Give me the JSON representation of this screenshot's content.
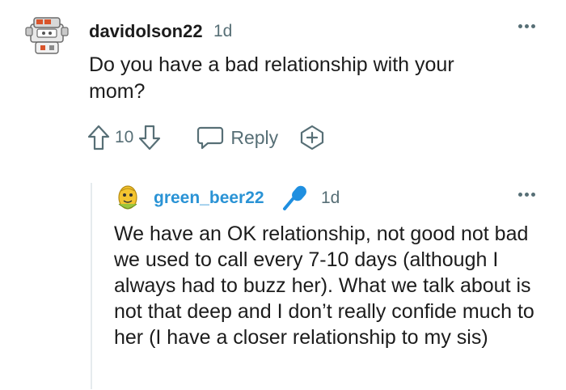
{
  "comment": {
    "username": "davidolson22",
    "time": "1d",
    "body": "Do you have a bad relationship with your mom?",
    "score": "10",
    "reply_label": "Reply",
    "avatar_icon": "robot-avatar-icon"
  },
  "reply": {
    "username": "green_beer22",
    "time": "1d",
    "flair_icon": "microphone-icon",
    "avatar_icon": "corn-avatar-icon",
    "body": "We have an OK relationship, not good not bad we used to call every 7-10 days (although I always had to buzz her). What we talk about is not that deep and I don’t really confide much to her (I have a closer relationship to my sis)"
  },
  "colors": {
    "username_reply": "#2a93d5",
    "meta_gray": "#576f76",
    "text": "#1c1c1c",
    "mic": "#1f8fe0"
  }
}
